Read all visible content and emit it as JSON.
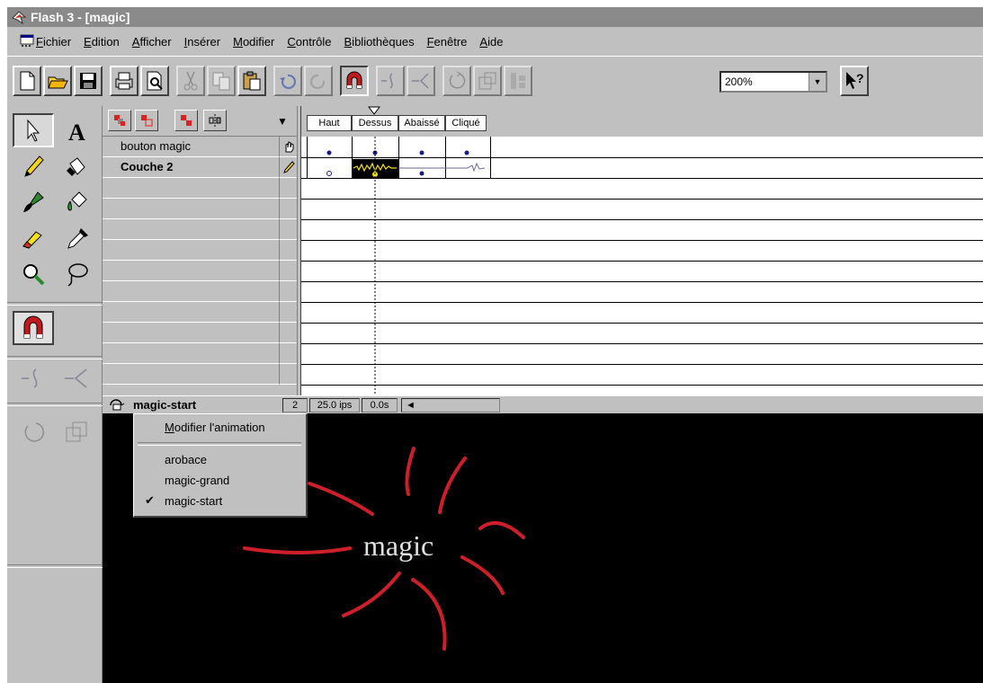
{
  "window": {
    "title": "Flash 3 - [magic]"
  },
  "menubar": {
    "items": [
      "Fichier",
      "Edition",
      "Afficher",
      "Insérer",
      "Modifier",
      "Contrôle",
      "Bibliothèques",
      "Fenêtre",
      "Aide"
    ]
  },
  "toolbar": {
    "zoom_value": "200%",
    "icons": [
      "new-icon",
      "open-icon",
      "save-icon",
      "print-icon",
      "print-preview-icon",
      "cut-icon",
      "copy-icon",
      "paste-icon",
      "undo-icon",
      "redo-icon",
      "snap-magnet-icon",
      "smooth-icon",
      "straighten-icon",
      "rotate-icon",
      "scale-icon",
      "align-icon",
      "help-pointer-icon"
    ]
  },
  "timeline": {
    "frame_labels": [
      "Haut",
      "Dessus",
      "Abaissé",
      "Cliqué"
    ],
    "layers": [
      {
        "name": "bouton magic",
        "bold": false,
        "icon": "hand-icon"
      },
      {
        "name": "Couche 2",
        "bold": true,
        "icon": "pencil-icon"
      }
    ],
    "scene": "magic-start",
    "current_frame": "2",
    "fps": "25.0 ips",
    "elapsed": "0.0s"
  },
  "scene_menu": {
    "edit_label": "Modifier l'animation",
    "scenes": [
      {
        "name": "arobace",
        "checked": false
      },
      {
        "name": "magic-grand",
        "checked": false
      },
      {
        "name": "magic-start",
        "checked": true
      }
    ]
  },
  "stage": {
    "text": "magic",
    "background": "#000000",
    "ray_color": "#cc1f2a"
  }
}
